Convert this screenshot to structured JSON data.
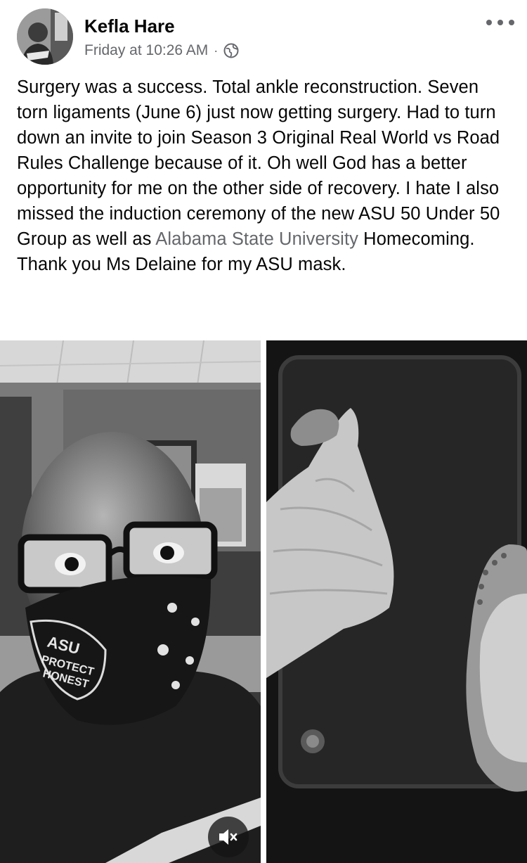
{
  "post": {
    "author": "Kefla Hare",
    "timestamp": "Friday at 10:26 AM",
    "separator": "·",
    "privacy_icon": "globe-icon",
    "more_icon": "more-options-icon",
    "body_before": "Surgery was a success. Total ankle reconstruction. Seven torn ligaments (June 6) just now getting surgery. Had to turn down an invite to join Season 3 Original Real World vs Road Rules Challenge because of it. Oh well God has a better opportunity for me on the other side of recovery. I hate I also missed the induction ceremony of the new ASU 50 Under 50 Group as well as ",
    "body_mention": "Alabama State University",
    "body_after": " Homecoming. Thank you Ms Delaine for my ASU mask."
  },
  "media": {
    "photos": [
      {
        "subject": "selfie-with-glasses-and-mask",
        "mask_text": [
          "ASU",
          "PROTECT",
          "HONEST"
        ]
      },
      {
        "subject": "leg-in-cast-with-clog"
      }
    ],
    "mute_icon": "speaker-muted-icon"
  },
  "colors": {
    "text_primary": "#050505",
    "text_secondary": "#65676b"
  }
}
